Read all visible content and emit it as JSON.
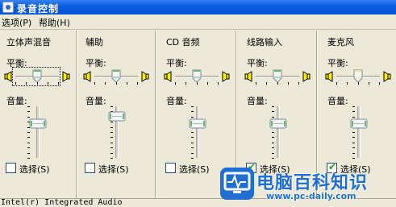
{
  "window": {
    "title": "录音控制"
  },
  "menu": [
    {
      "label": "选项(P)"
    },
    {
      "label": "帮助(H)"
    }
  ],
  "labels": {
    "balance": "平衡:",
    "volume": "音量:",
    "mute": "选择(S)"
  },
  "channels": [
    {
      "name": "立体声混音",
      "balance": 0.0,
      "volume": 0.75,
      "selected": false
    },
    {
      "name": "辅助",
      "balance": 0.0,
      "volume": 0.9,
      "selected": false
    },
    {
      "name": "CD 音频",
      "balance": 0.0,
      "volume": 0.75,
      "selected": false
    },
    {
      "name": "线路输入",
      "balance": 0.0,
      "volume": 0.75,
      "selected": true
    },
    {
      "name": "麦克风",
      "balance": 0.0,
      "volume": 0.75,
      "selected": true
    }
  ],
  "status": {
    "device": "Intel(r) Integrated Audio"
  },
  "watermark": {
    "text": "电脑百科知识",
    "url": "www.pc-daily.com"
  },
  "colors": {
    "titlebar": "#0A5FE0",
    "face": "#ECE9D8",
    "thumb_green": "#6BB76B",
    "watermark": "#1E6FD1"
  }
}
